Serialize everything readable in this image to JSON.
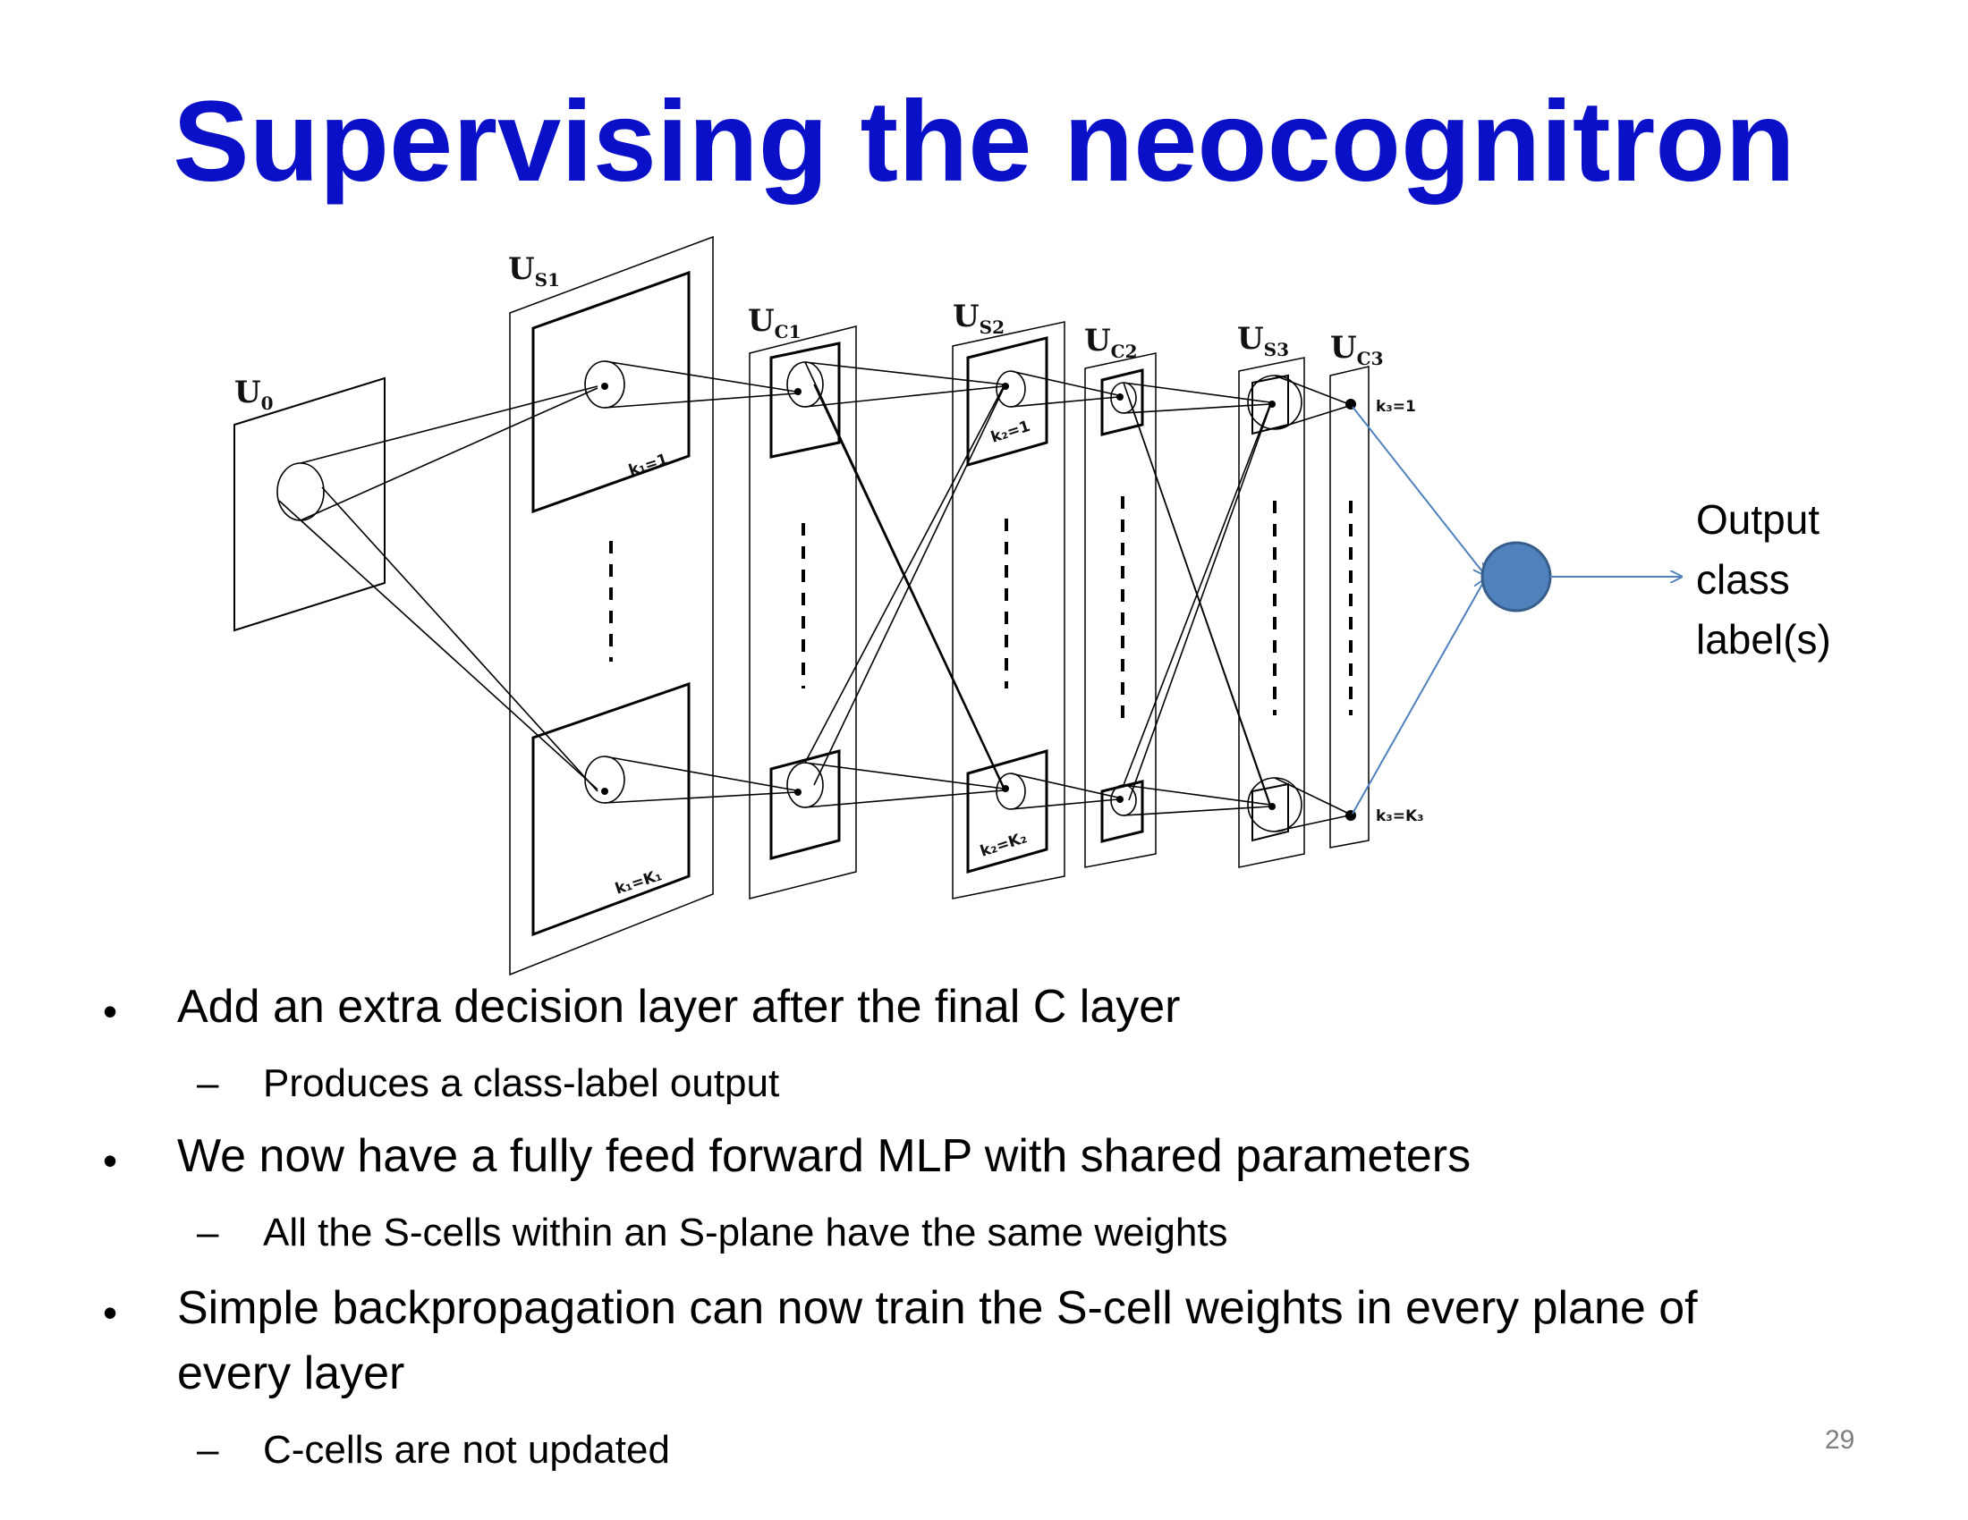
{
  "title": "Supervising the neocognitron",
  "diagram": {
    "layer_labels": [
      "U",
      "U",
      "U",
      "U",
      "U",
      "U",
      "U"
    ],
    "layer_subs": [
      "0",
      "S1",
      "C1",
      "S2",
      "C2",
      "S3",
      "C3"
    ],
    "plane_labels": [
      "k₁=1",
      "k₁=K₁",
      "k₂=1",
      "k₂=K₂",
      "k₃=1",
      "k₃=K₃"
    ],
    "output_label": [
      "Output",
      "class",
      "label(s)"
    ],
    "accent_color": "#4f81bd"
  },
  "bullets": [
    {
      "text": "Add an extra decision layer after the final C layer",
      "sub": "Produces a class-label output"
    },
    {
      "text": "We now have a fully feed forward MLP with shared parameters",
      "sub": "All the S-cells within an S-plane have the same weights"
    },
    {
      "text": "Simple backpropagation can now train the S-cell weights in every plane of",
      "text2": "every layer",
      "sub": "C-cells are not updated"
    }
  ],
  "bullet_glyph": "•",
  "dash_glyph": "–",
  "page_number": "29"
}
